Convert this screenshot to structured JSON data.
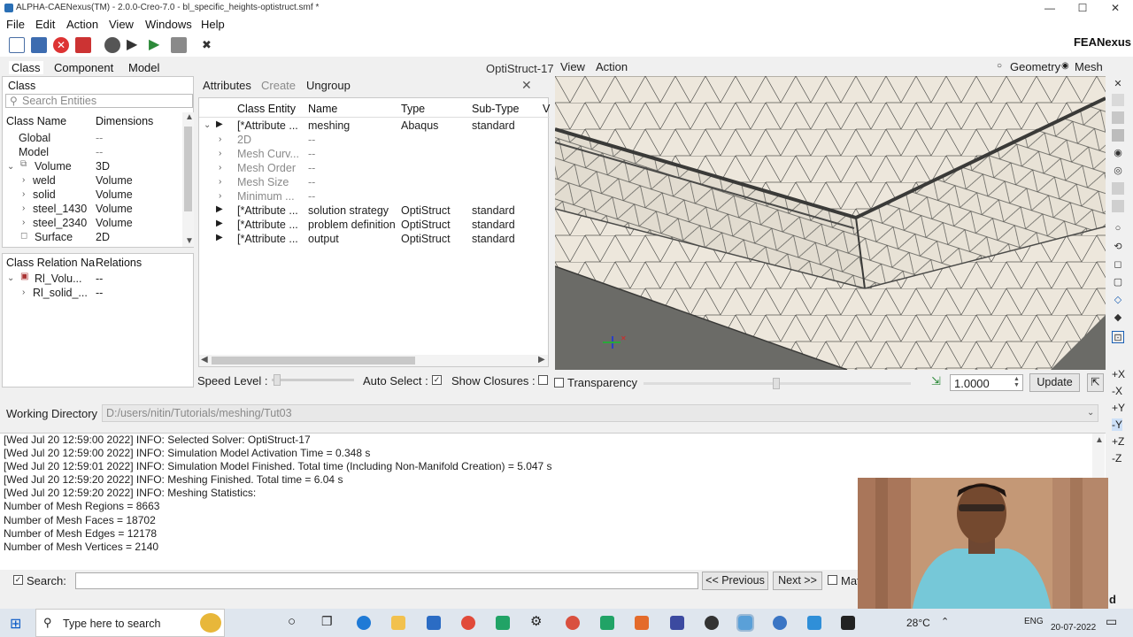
{
  "window": {
    "title": "ALPHA-CAENexus(TM) - 2.0.0-Creo-7.0 - bl_specific_heights-optistruct.smf *",
    "minimize": "—",
    "maximize": "☐",
    "close": "✕"
  },
  "menu": [
    "File",
    "Edit",
    "Action",
    "View",
    "Windows",
    "Help"
  ],
  "brand": "FEANexus",
  "left_tabs": [
    "Class",
    "Component",
    "Model"
  ],
  "solver_label": "OptiStruct-17",
  "class_panel": {
    "title": "Class",
    "search_placeholder": "Search Entities",
    "col1": "Class Name",
    "col2": "Dimensions",
    "rows": [
      {
        "name": "Global",
        "dim": "--"
      },
      {
        "name": "Model",
        "dim": "--"
      },
      {
        "name": "Volume",
        "dim": "3D"
      },
      {
        "name": "weld",
        "dim": "Volume"
      },
      {
        "name": "solid",
        "dim": "Volume"
      },
      {
        "name": "steel_1430",
        "dim": "Volume"
      },
      {
        "name": "steel_2340",
        "dim": "Volume"
      },
      {
        "name": "Surface",
        "dim": "2D"
      }
    ]
  },
  "relation_panel": {
    "col1": "Class Relation Na",
    "col2": "Relations",
    "rows": [
      {
        "name": "Rl_Volu...",
        "rel": "--"
      },
      {
        "name": "Rl_solid_...",
        "rel": "--"
      }
    ]
  },
  "attr_panel": {
    "tabs": [
      "Attributes",
      "Create",
      "Ungroup"
    ],
    "close": "✕",
    "cols": [
      "Class Entity",
      "Name",
      "Type",
      "Sub-Type",
      "V"
    ],
    "rows": [
      {
        "entity": "[*Attribute ...",
        "name": "meshing",
        "type": "Abaqus",
        "sub": "standard"
      },
      {
        "entity": "2D",
        "name": "--",
        "type": "",
        "sub": ""
      },
      {
        "entity": "Mesh Curv...",
        "name": "--",
        "type": "",
        "sub": ""
      },
      {
        "entity": "Mesh Order",
        "name": "--",
        "type": "",
        "sub": ""
      },
      {
        "entity": "Mesh Size",
        "name": "--",
        "type": "",
        "sub": ""
      },
      {
        "entity": "Minimum ...",
        "name": "--",
        "type": "",
        "sub": ""
      },
      {
        "entity": "[*Attribute ...",
        "name": "solution strategy",
        "type": "OptiStruct",
        "sub": "standard"
      },
      {
        "entity": "[*Attribute ...",
        "name": "problem definition",
        "type": "OptiStruct",
        "sub": "standard"
      },
      {
        "entity": "[*Attribute ...",
        "name": "output",
        "type": "OptiStruct",
        "sub": "standard"
      }
    ]
  },
  "speed": {
    "label": "Speed Level :",
    "auto_select": "Auto Select :",
    "show_closures": "Show Closures :"
  },
  "view_menu": [
    "View",
    "Action"
  ],
  "display_mode": {
    "geometry": "Geometry",
    "mesh": "Mesh"
  },
  "view_controls": {
    "transparency": "Transparency",
    "scale": "1.0000",
    "update": "Update"
  },
  "axis_buttons": [
    "+X",
    "-X",
    "+Y",
    "-Y",
    "+Z",
    "-Z"
  ],
  "working_dir": {
    "label": "Working Directory",
    "value": "D:/users/nitin/Tutorials/meshing/Tut03"
  },
  "console": [
    "[Wed Jul 20 12:59:00 2022] INFO:   Selected Solver: OptiStruct-17",
    "[Wed Jul 20 12:59:00 2022] INFO:   Simulation Model Activation Time = 0.348 s",
    "[Wed Jul 20 12:59:01 2022] INFO:   Simulation Model Finished. Total time (Including Non-Manifold Creation) = 5.047 s",
    "[Wed Jul 20 12:59:20 2022] INFO:   Meshing Finished. Total time = 6.04 s",
    "[Wed Jul 20 12:59:20 2022] INFO:   Meshing Statistics:",
    "Number of Mesh Regions   = 8663",
    "Number of Mesh Faces    = 18702",
    "Number of Mesh Edges    = 12178",
    "Number of Mesh Vertices = 2140"
  ],
  "search_bar": {
    "label": "Search:",
    "previous": "<< Previous",
    "next": "Next >>",
    "match": "Mat",
    "trailing": "d"
  },
  "taskbar": {
    "search": "Type here to search",
    "temp": "28°C",
    "lang": "ENG",
    "date": "20-07-2022"
  },
  "colors": {
    "mesh_face": "#ece6da",
    "mesh_dark": "#6a6a66",
    "link": "#1a5fb4"
  }
}
